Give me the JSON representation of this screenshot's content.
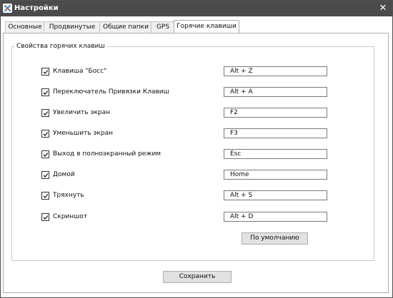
{
  "window": {
    "title": "Настройки",
    "icon": "settings-app-icon",
    "close_label": "✕"
  },
  "tabs": [
    {
      "label": "Основные",
      "active": false
    },
    {
      "label": "Продвинутые",
      "active": false
    },
    {
      "label": "Общие папки",
      "active": false
    },
    {
      "label": "GPS",
      "active": false
    },
    {
      "label": "Горячие клавиши",
      "active": true
    }
  ],
  "hotkeys": {
    "group_title": "Свойства горячих клавиш",
    "rows": [
      {
        "label": "Клавиша \"Босс\"",
        "value": "Alt + Z",
        "checked": true
      },
      {
        "label": "Переключатель Привязки Клавиш",
        "value": "Alt + A",
        "checked": true
      },
      {
        "label": "Увеличить экран",
        "value": "F2",
        "checked": true
      },
      {
        "label": "Уменьшить экран",
        "value": "F3",
        "checked": true
      },
      {
        "label": "Выход в полноэкранный режим",
        "value": "Esc",
        "checked": true
      },
      {
        "label": "Домой",
        "value": "Home",
        "checked": true
      },
      {
        "label": "Тряхнуть",
        "value": "Alt + S",
        "checked": true
      },
      {
        "label": "Скриншот",
        "value": "Alt + D",
        "checked": true
      }
    ],
    "default_button": "По умолчанию"
  },
  "footer": {
    "save_button": "Сохранить"
  },
  "colors": {
    "titlebar": "#4b4b4b",
    "button": "#e1e1e1"
  }
}
